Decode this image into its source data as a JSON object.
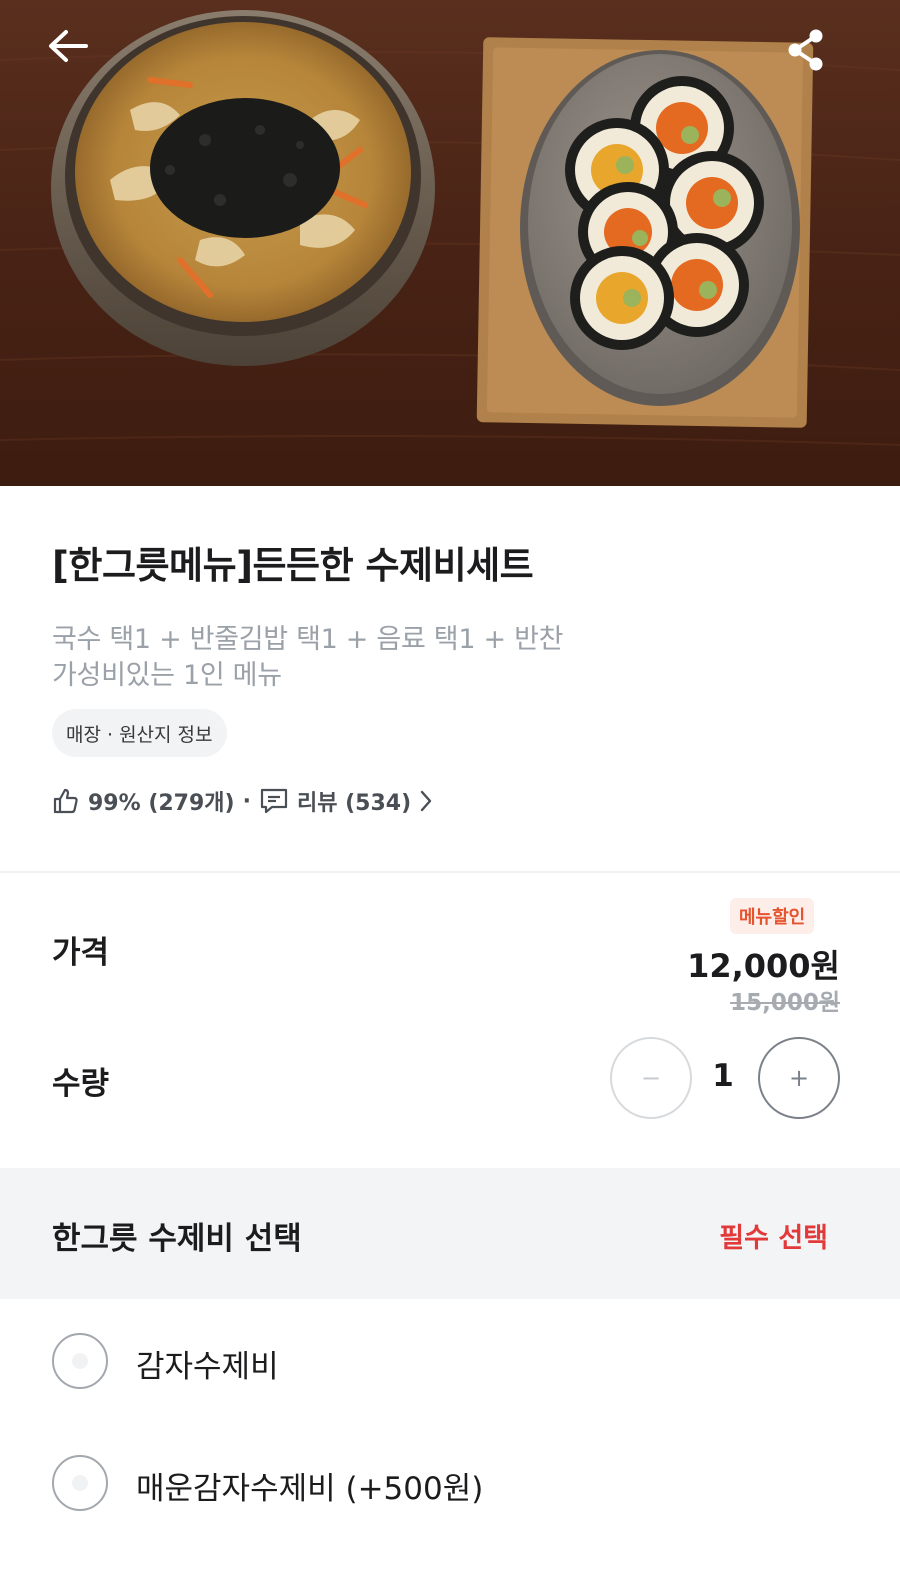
{
  "menu": {
    "title": "[한그릇메뉴]든든한 수제비세트",
    "description_line1": "국수 택1 + 반줄김밥 택1 + 음료 택1 + 반찬",
    "description_line2": "가성비있는 1인 메뉴",
    "info_chip": "매장 · 원산지 정보",
    "rating": "99% (279개)",
    "separator": "·",
    "reviews": "리뷰 (534)"
  },
  "pricing": {
    "price_label": "가격",
    "discount_badge": "메뉴할인",
    "price": "12,000원",
    "original_price": "15,000원",
    "quantity_label": "수량",
    "quantity": "1",
    "minus_symbol": "−",
    "plus_symbol": "+"
  },
  "option_group": {
    "title": "한그릇 수제비 선택",
    "required_label": "필수 선택",
    "options": [
      {
        "label": "감자수제비",
        "selected": false
      },
      {
        "label": "매운감자수제비 (+500원)",
        "selected": false
      }
    ]
  },
  "icons": {
    "back": "arrow-left-icon",
    "share": "share-icon",
    "like": "thumbs-up-icon",
    "review": "comment-icon",
    "chevron": "chevron-right-icon"
  },
  "colors": {
    "accent_red": "#e23a3a",
    "discount_orange": "#e5532f",
    "muted_text": "#9ba1a8"
  }
}
